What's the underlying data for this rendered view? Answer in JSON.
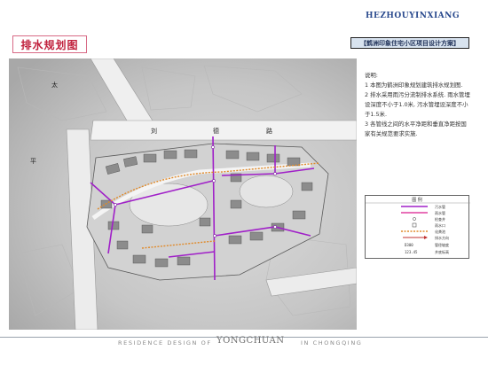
{
  "title": "排水规划图",
  "brand": "HEZHOUYINXIANG",
  "project": "【鹤洲印象住宅小区项目设计方案】",
  "map_labels": {
    "road_a": "太",
    "road_b": "平",
    "road_c": "刘",
    "road_d": "德",
    "road_e": "路"
  },
  "notes": {
    "heading": "说明:",
    "items": [
      "1 本图为鹤洲印象规划建筑排水规划图.",
      "2 排水采用雨污分流制排水系统. 雨水管埋",
      "设深度不小于1.0米, 污水管埋设深度不小",
      "于1.5米.",
      "3 各管线之间的水平净距和垂直净距按国",
      "家有关规范要求实施."
    ]
  },
  "legend": {
    "title": "图 例",
    "items": [
      {
        "symbol": "purple-line",
        "label": "污水管",
        "color": "#a020c8"
      },
      {
        "symbol": "pink-line",
        "label": "雨水管",
        "color": "#e040a0"
      },
      {
        "symbol": "circle",
        "label": "检查井",
        "color": "#333333"
      },
      {
        "symbol": "square",
        "label": "雨水口",
        "color": "#333333"
      },
      {
        "symbol": "orange-dotted-line",
        "label": "化粪池",
        "color": "#e08a2a"
      },
      {
        "symbol": "arrow",
        "label": "排水方向",
        "color": "#c03030"
      },
      {
        "symbol": "text-sample",
        "label": "管径坡度",
        "sample": "D300"
      },
      {
        "symbol": "text-sample",
        "label": "井底标高",
        "sample": "123.45"
      }
    ]
  },
  "footer": {
    "left": "RESIDENCE DESIGN OF",
    "brand": "YONGCHUAN",
    "right": "IN CHONGQING"
  }
}
